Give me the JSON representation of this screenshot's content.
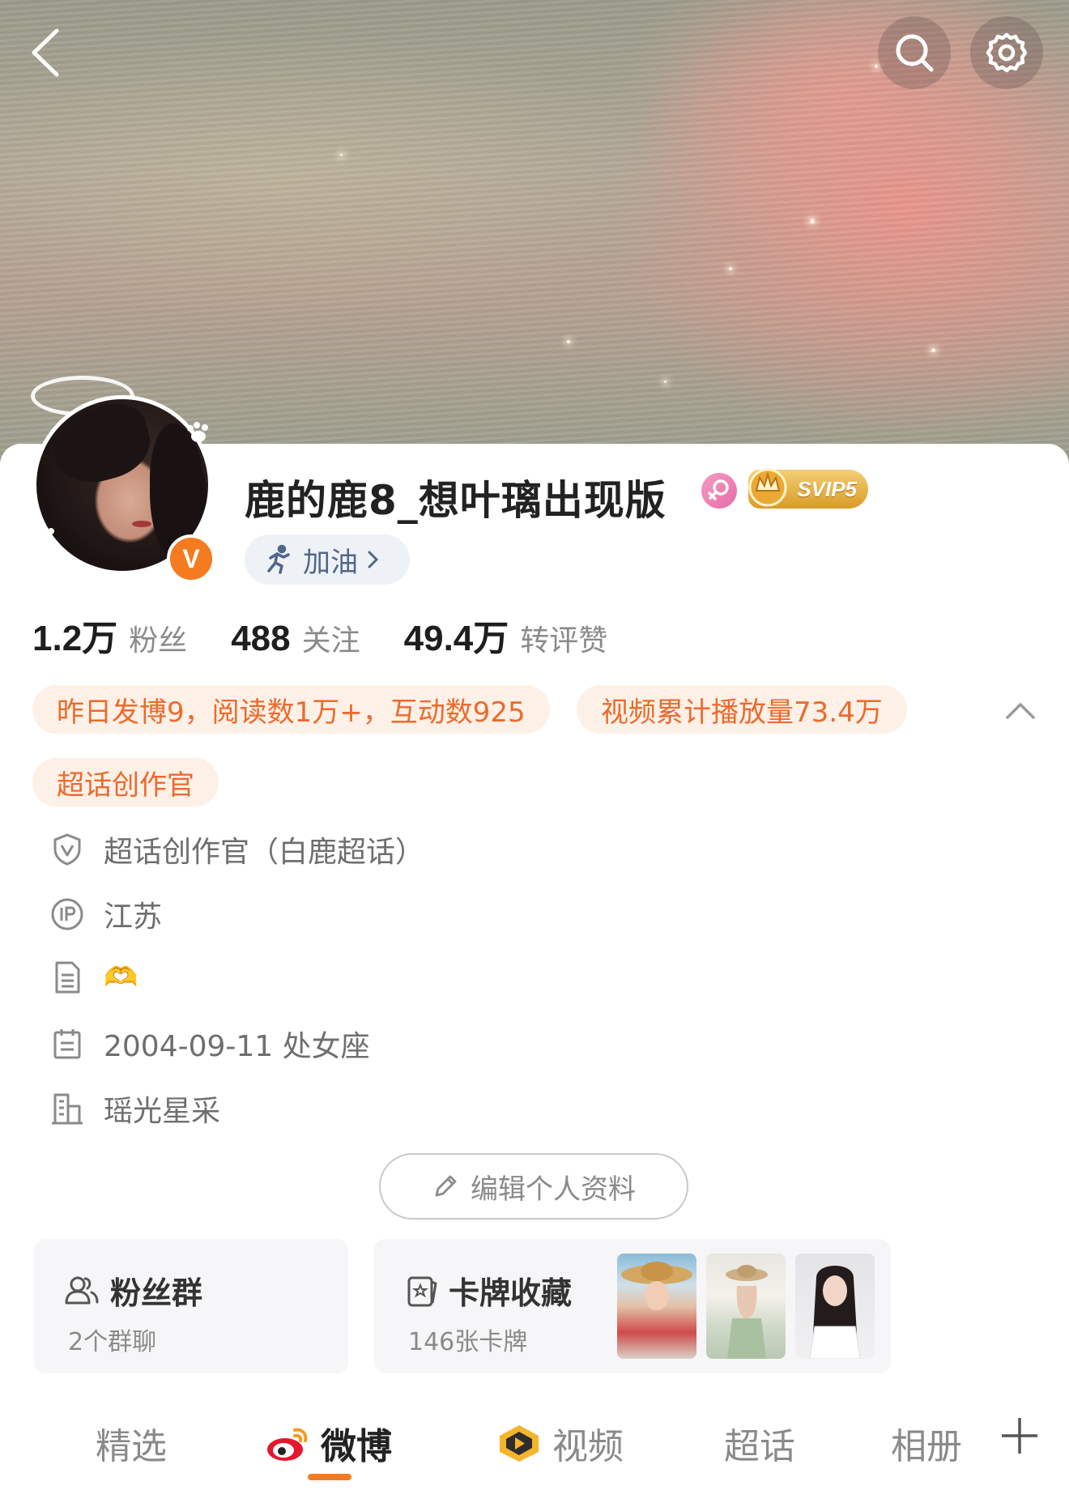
{
  "header": {
    "back_icon": "chevron-left-icon",
    "search_icon": "search-icon",
    "settings_icon": "gear-icon"
  },
  "profile": {
    "name": "鹿的鹿8_想叶璃出现版",
    "gender_icon": "female-icon",
    "vip_label": "SVIP5",
    "verified_label": "V",
    "cheer_label": "加油",
    "accent_color": "#f57b20"
  },
  "stats": [
    {
      "value": "1.2万",
      "label": "粉丝"
    },
    {
      "value": "488",
      "label": "关注"
    },
    {
      "value": "49.4万",
      "label": "转评赞"
    }
  ],
  "tags": {
    "yesterday": "昨日发博9，阅读数1万+，互动数925",
    "video": "视频累计播放量73.4万",
    "creator": "超话创作官"
  },
  "info": {
    "certification": "超话创作官（白鹿超话）",
    "ip_location": "江苏",
    "bio": "🫶",
    "birthday": "2004-09-11 处女座",
    "company": "瑶光星采"
  },
  "edit_profile_label": "编辑个人资料",
  "fan_group": {
    "title": "粉丝群",
    "subtitle": "2个群聊"
  },
  "card_collection": {
    "title": "卡牌收藏",
    "subtitle": "146张卡牌"
  },
  "tabs": [
    {
      "label": "精选"
    },
    {
      "label": "微博"
    },
    {
      "label": "视频"
    },
    {
      "label": "超话"
    },
    {
      "label": "相册"
    }
  ],
  "active_tab": "微博"
}
